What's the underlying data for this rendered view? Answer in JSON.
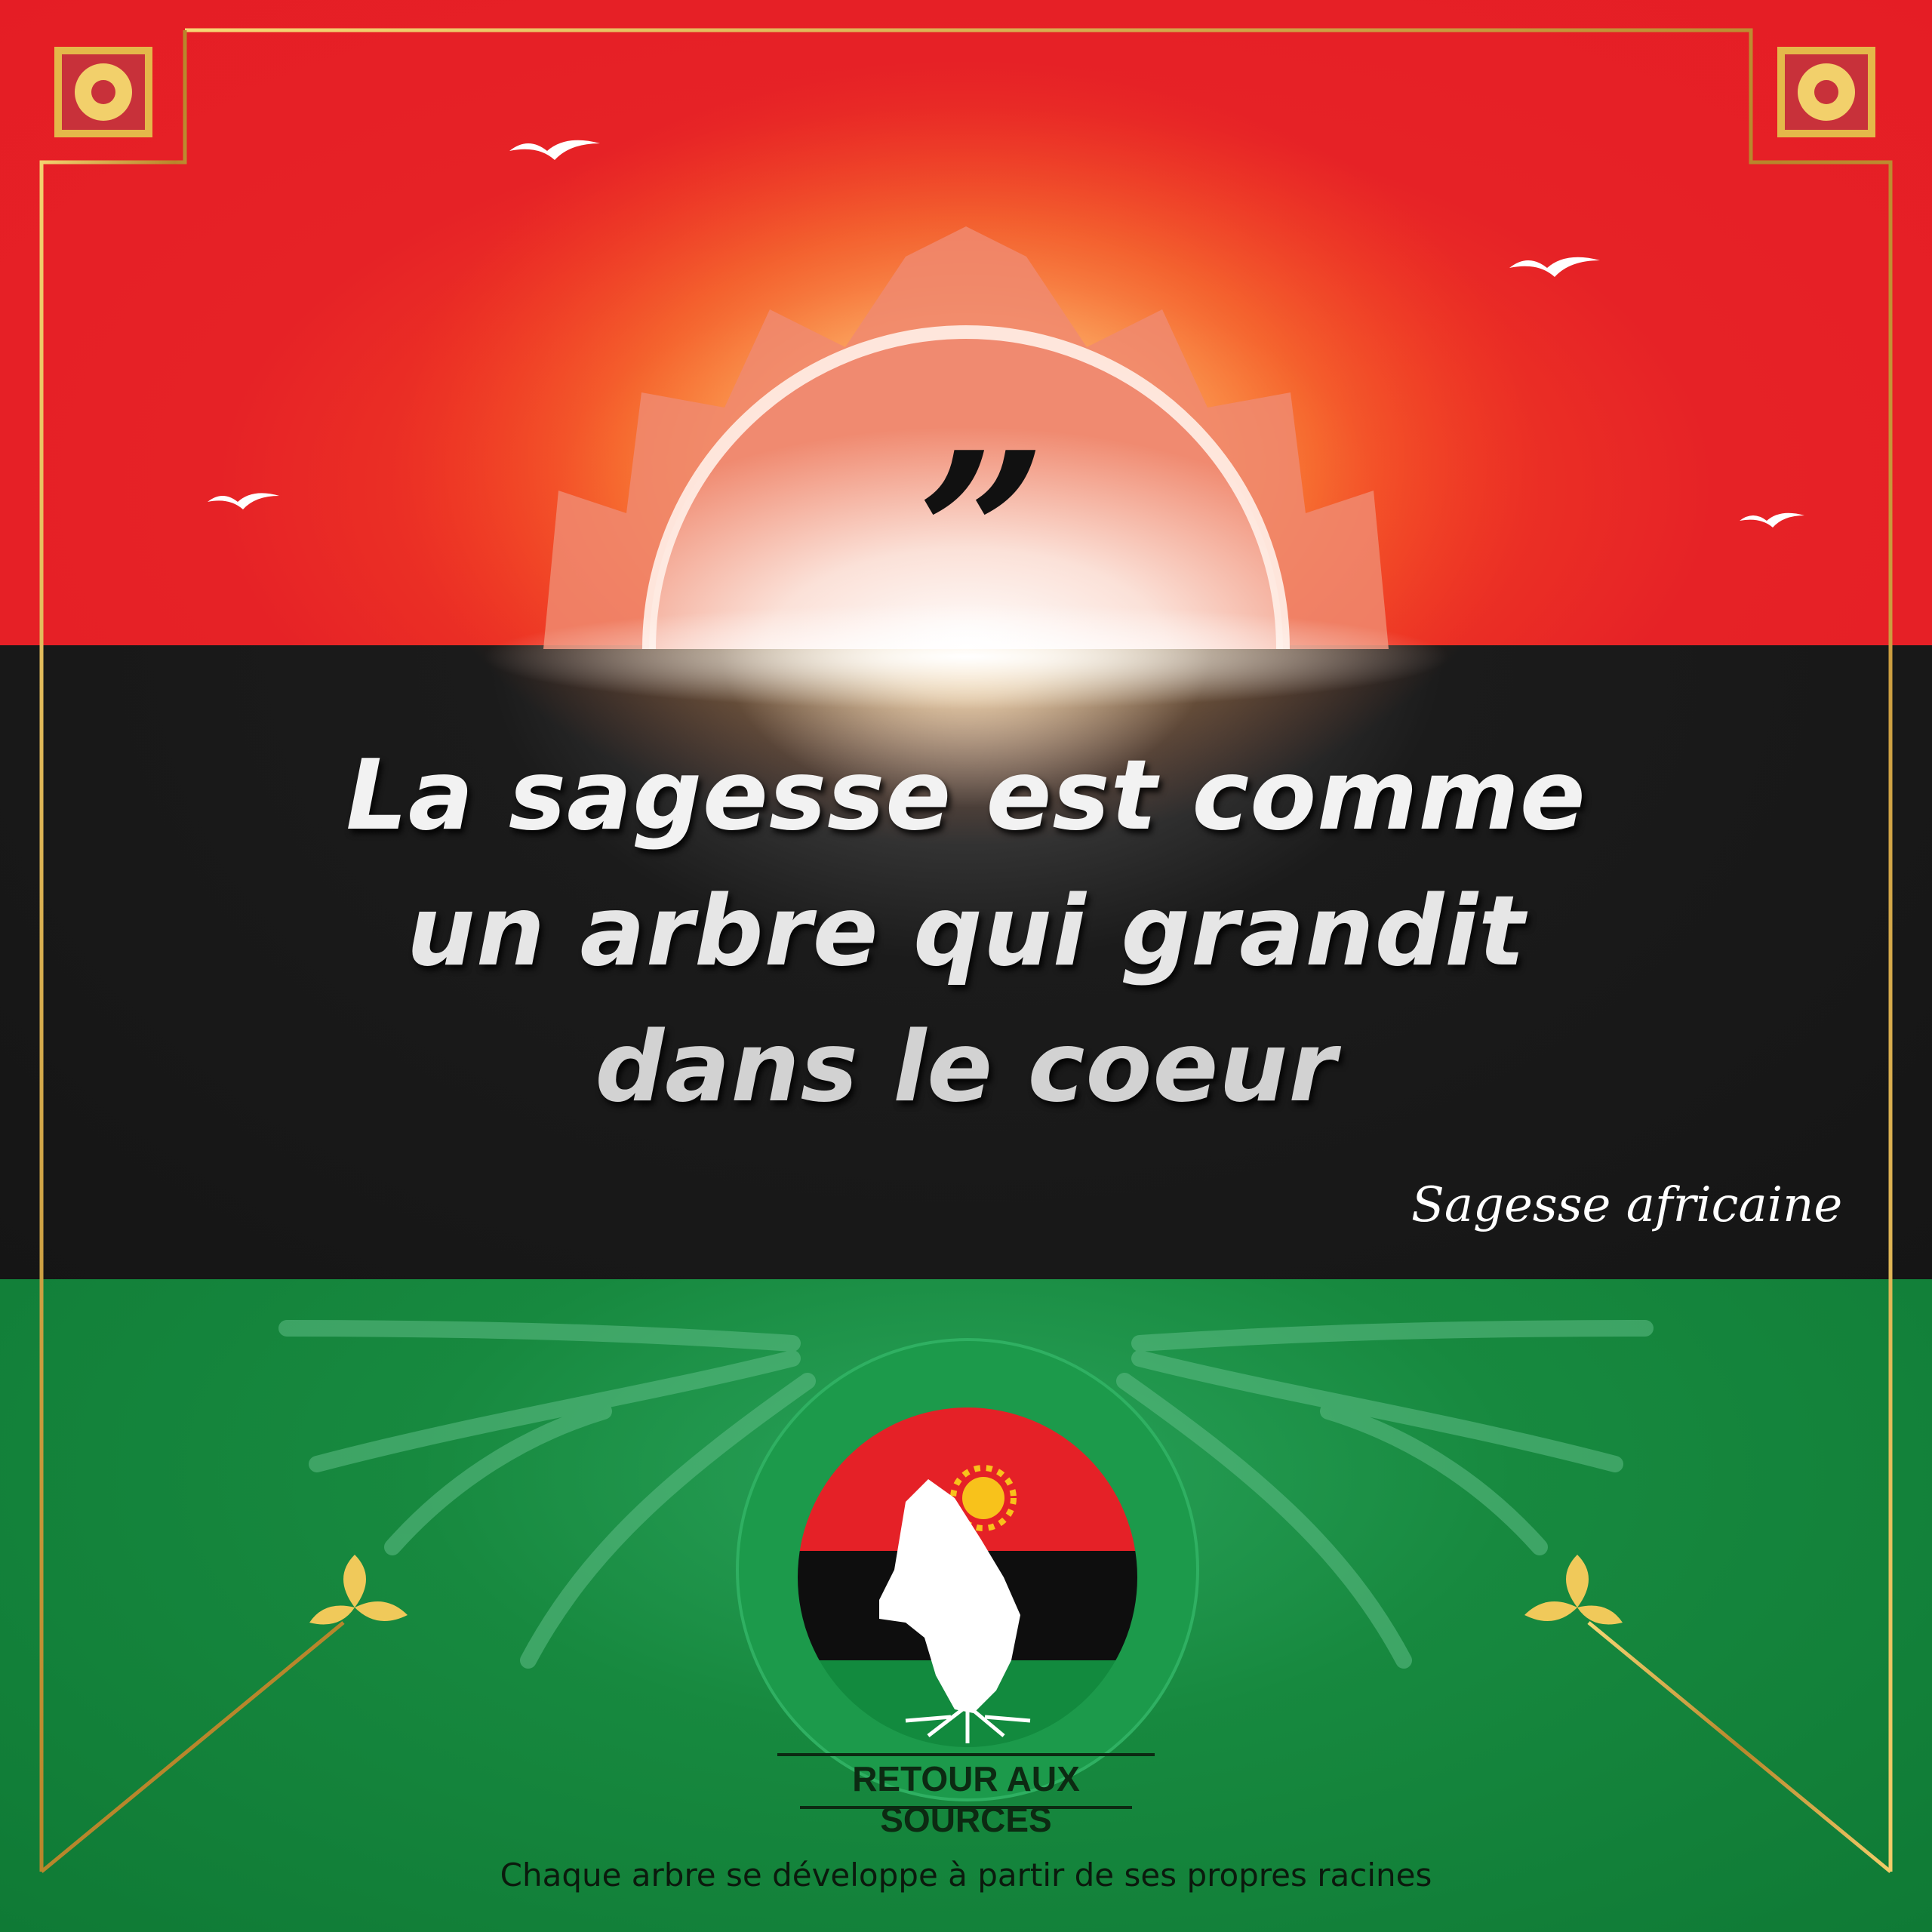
{
  "quote": {
    "mark": "”",
    "lines": [
      "La sagesse est comme",
      "un arbre qui grandit",
      "dans le coeur"
    ],
    "author": "Sagesse africaine"
  },
  "logo": {
    "name": "RETOUR AUX SOURCES"
  },
  "tagline": "Chaque arbre se développe à partir de ses propres racines",
  "colors": {
    "red": "#e51d25",
    "black": "#151515",
    "green": "#128a3e",
    "gold": "#d4a63a"
  }
}
